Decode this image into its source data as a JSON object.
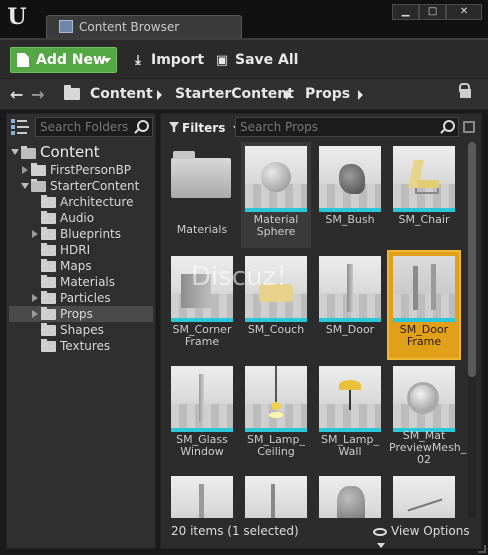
{
  "window": {
    "tab_title": "Content Browser",
    "minimize": "▁",
    "maximize": "□",
    "close": "✕"
  },
  "toolbar": {
    "add_new": "Add New",
    "import": "Import",
    "save_all": "Save All"
  },
  "path": {
    "crumbs": [
      "Content",
      "StarterContent",
      "Props"
    ]
  },
  "folders": {
    "search_placeholder": "Search Folders",
    "tree": [
      {
        "label": "Content",
        "level": 0,
        "expanded": true
      },
      {
        "label": "FirstPersonBP",
        "level": 1,
        "expandable": true
      },
      {
        "label": "StarterContent",
        "level": 1,
        "expanded": true
      },
      {
        "label": "Architecture",
        "level": 2
      },
      {
        "label": "Audio",
        "level": 2
      },
      {
        "label": "Blueprints",
        "level": 2,
        "expandable": true
      },
      {
        "label": "HDRI",
        "level": 2
      },
      {
        "label": "Maps",
        "level": 2
      },
      {
        "label": "Materials",
        "level": 2
      },
      {
        "label": "Particles",
        "level": 2,
        "expandable": true
      },
      {
        "label": "Props",
        "level": 2,
        "expandable": true,
        "selected": true
      },
      {
        "label": "Shapes",
        "level": 2
      },
      {
        "label": "Textures",
        "level": 2
      }
    ]
  },
  "assets": {
    "filters_label": "Filters",
    "search_placeholder": "Search Props",
    "items": [
      {
        "label": "Materials"
      },
      {
        "label": "Material Sphere"
      },
      {
        "label": "SM_Bush"
      },
      {
        "label": "SM_Chair"
      },
      {
        "label": "SM_Corner Frame"
      },
      {
        "label": "SM_Couch"
      },
      {
        "label": "SM_Door"
      },
      {
        "label": "SM_Door Frame",
        "selected": true
      },
      {
        "label": "SM_Glass Window"
      },
      {
        "label": "SM_Lamp_ Ceiling"
      },
      {
        "label": "SM_Lamp_ Wall"
      },
      {
        "label": "SM_Mat PreviewMesh_ 02"
      },
      {
        "label": ""
      },
      {
        "label": ""
      },
      {
        "label": ""
      },
      {
        "label": ""
      }
    ],
    "status": "20 items (1 selected)",
    "view_options": "View Options"
  },
  "watermark": "Discuz!",
  "colors": {
    "accent_green": "#55a644",
    "selection_orange": "#e1a01a",
    "thumb_bar": "#29c7d8"
  }
}
